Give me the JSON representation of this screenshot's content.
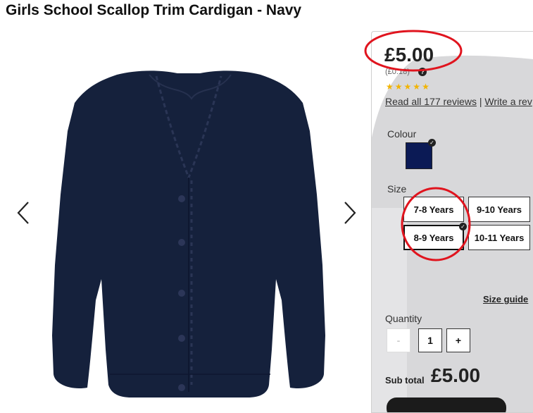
{
  "product": {
    "title": "Girls School Scallop Trim Cardigan - Navy",
    "image_icon": "navy-cardigan-image"
  },
  "gallery": {
    "prev_icon": "chevron-left-icon",
    "next_icon": "chevron-right-icon"
  },
  "purchase": {
    "price": "£5.00",
    "price_per": "(£0.18)",
    "help_icon": "?",
    "rating_stars": 5,
    "reviews_link": "Read all 177 reviews",
    "separator": "|",
    "write_review": "Write a rev",
    "colour_label": "Colour",
    "selected_colour": "#0b1a55",
    "size_label": "Size",
    "sizes": [
      {
        "label": "7-8 Years"
      },
      {
        "label": "9-10 Years"
      },
      {
        "label": "8-9 Years",
        "selected": true
      },
      {
        "label": "10-11 Years"
      }
    ],
    "size_guide": "Size guide",
    "quantity_label": "Quantity",
    "quantity": {
      "minus": "-",
      "value": "1",
      "plus": "+"
    },
    "subtotal_label": "Sub total",
    "subtotal_value": "£5.00"
  },
  "colors": {
    "annotation": "#e0141e",
    "navy": "#0b1a55"
  }
}
